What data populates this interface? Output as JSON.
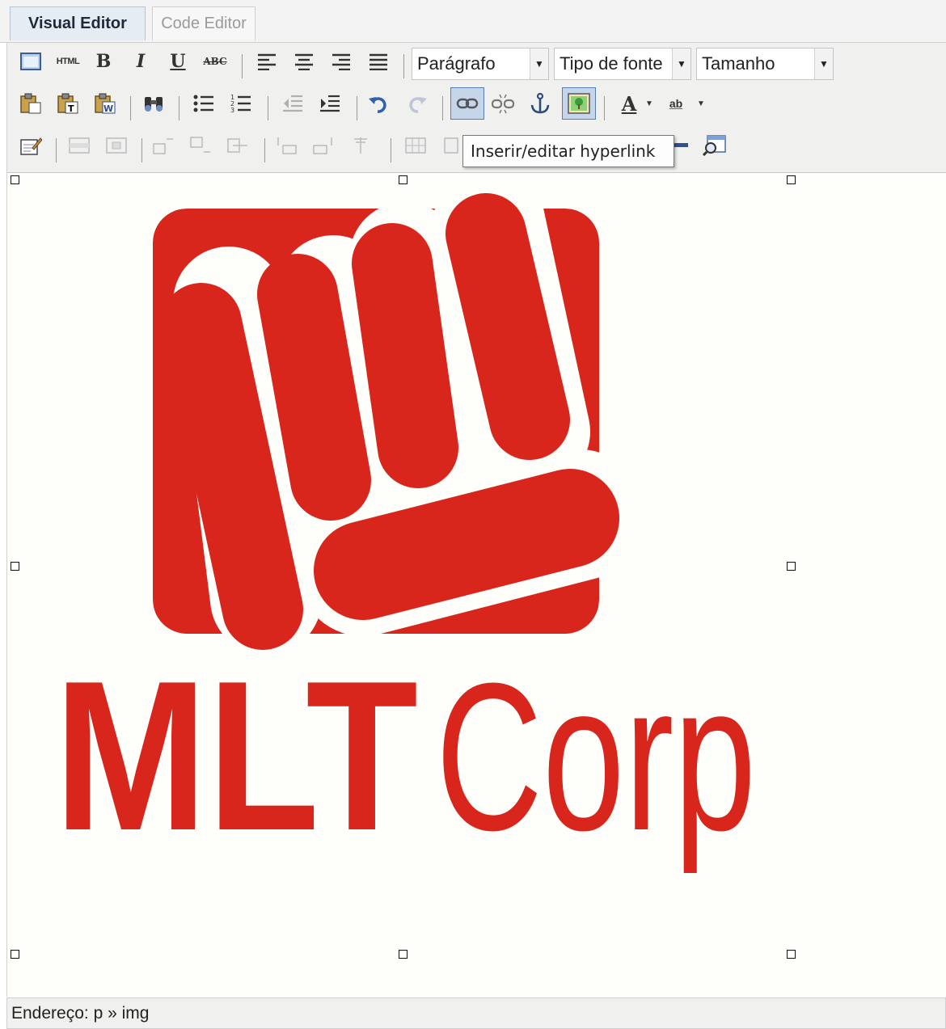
{
  "tabs": {
    "visual": "Visual Editor",
    "code": "Code Editor"
  },
  "toolbar": {
    "paragraph_select": "Parágrafo",
    "font_select": "Tipo de fonte",
    "size_select": "Tamanho",
    "html_label": "HTML",
    "bold": "B",
    "italic": "I",
    "underline": "U",
    "strikethrough": "ABC",
    "font_color_letter": "A",
    "highlight_label": "ab"
  },
  "tooltip": "Inserir/editar hyperlink",
  "logo": {
    "word1": "MLT",
    "word2": "Corp",
    "color": "#d9261c"
  },
  "statusbar": {
    "path": "Endereço: p » img"
  }
}
